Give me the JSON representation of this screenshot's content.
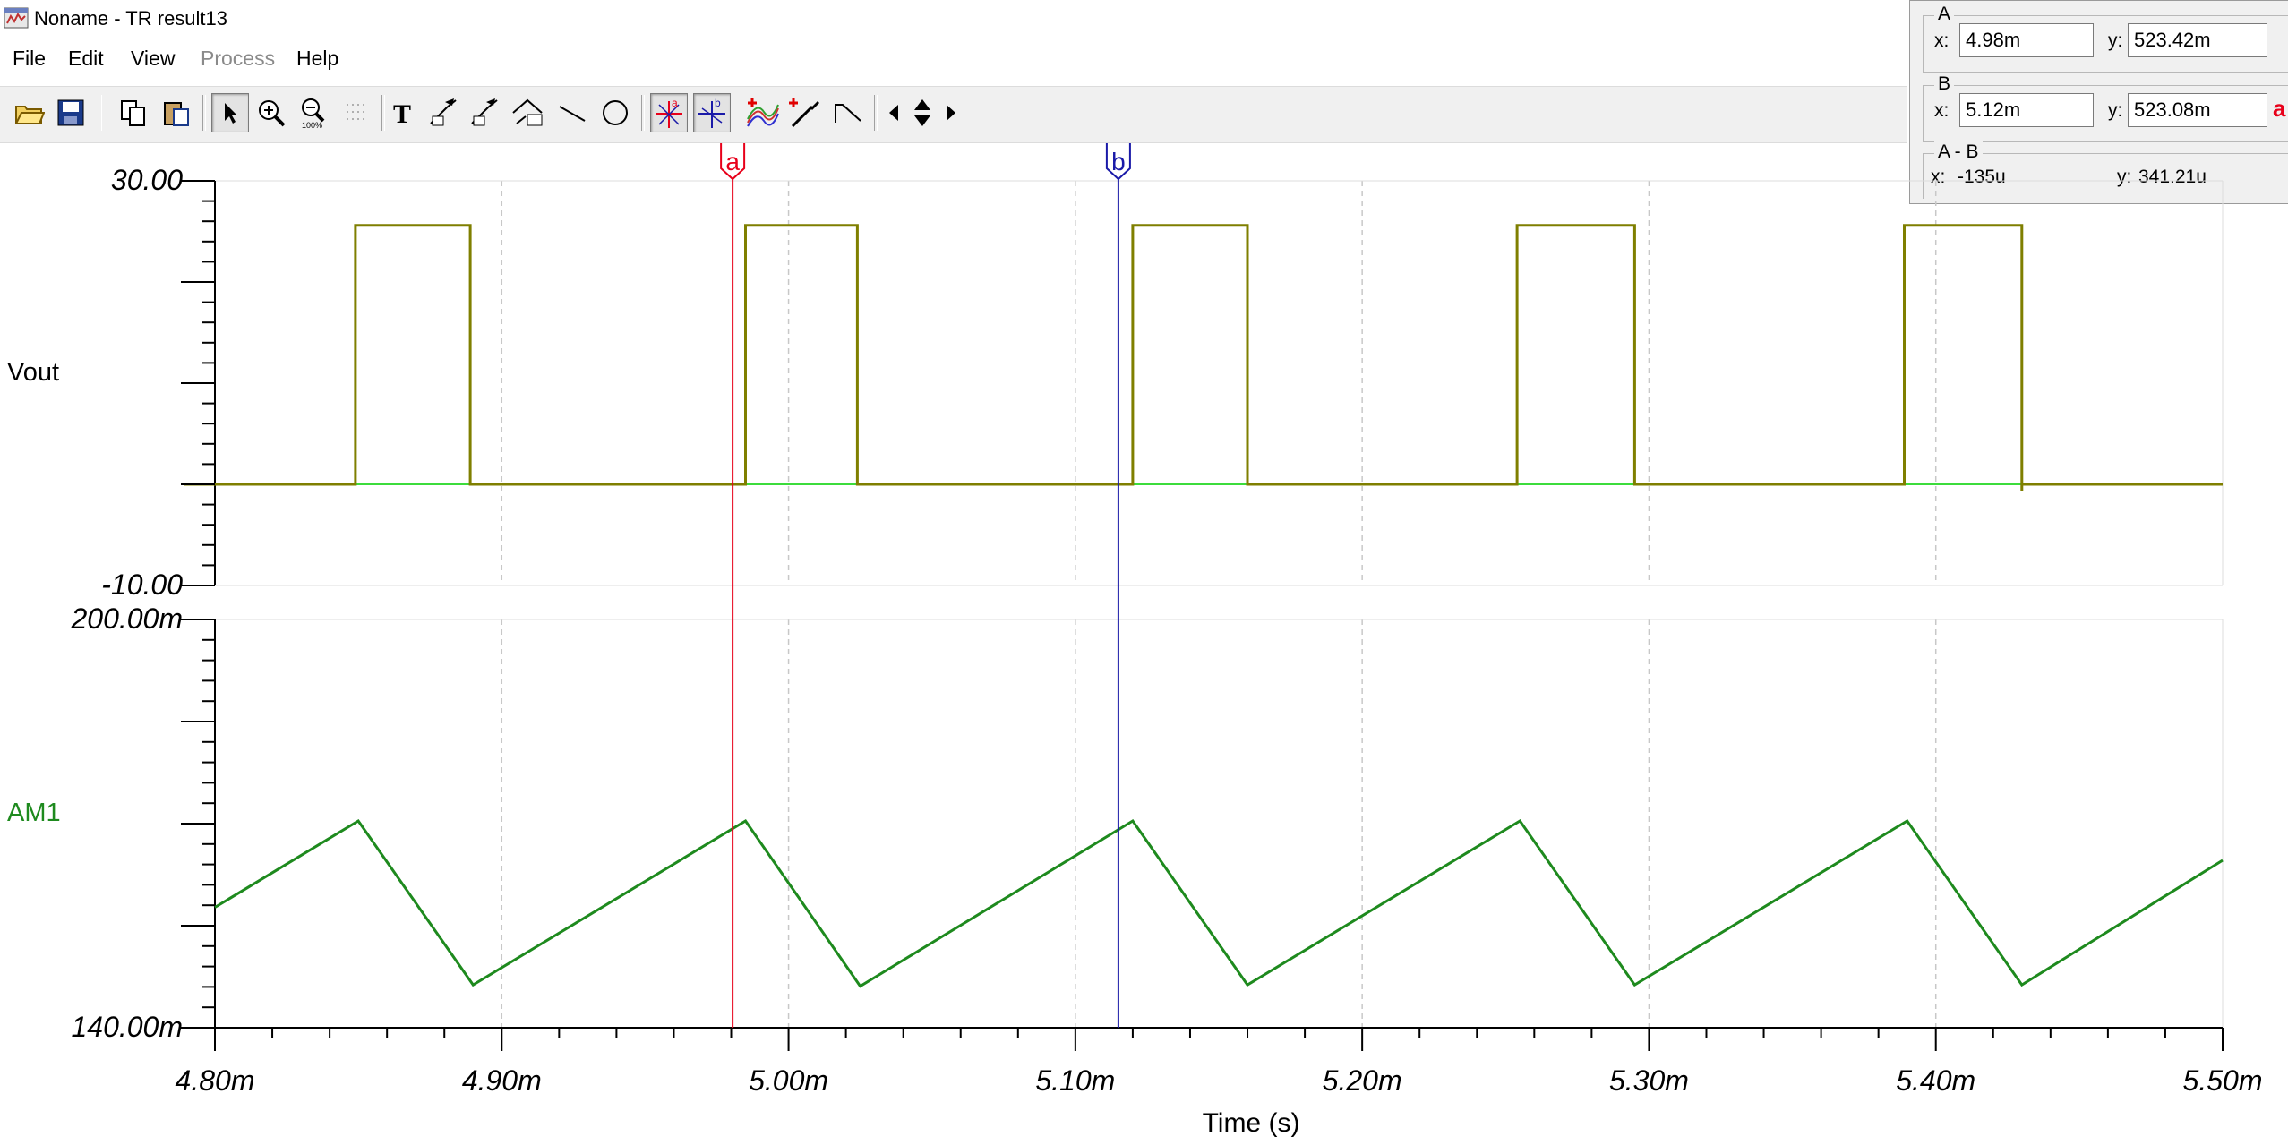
{
  "window": {
    "title": "Noname - TR result13"
  },
  "menu": {
    "file": "File",
    "edit": "Edit",
    "view": "View",
    "process": "Process",
    "help": "Help"
  },
  "toolbar": {
    "buttons": [
      "open-icon",
      "save-icon",
      "copy-icon",
      "paste-icon",
      "select-arrow-icon",
      "zoom-in-icon",
      "zoom-100-icon",
      "grid-icon",
      "text-icon",
      "label-tool-icon",
      "label-tool-2-icon",
      "diagram-label-icon",
      "line-icon",
      "circle-icon",
      "cursor-a-icon",
      "cursor-b-icon",
      "add-curve-icon",
      "probe-icon",
      "step-icon",
      "prev-icon",
      "updown-icon",
      "next-icon"
    ],
    "text_tool_glyph": "T"
  },
  "cursor_panel": {
    "a": {
      "title": "A",
      "x_label": "x:",
      "x_value": "4.98m",
      "y_label": "y:",
      "y_value": "523.42m"
    },
    "b": {
      "title": "B",
      "x_label": "x:",
      "x_value": "5.12m",
      "y_label": "y:",
      "y_value": "523.08m",
      "arrow_label": "a←"
    },
    "diff": {
      "title": "A - B",
      "x_label": "x:",
      "x_value": "-135u",
      "y_label": "y:",
      "y_value": "341.21u"
    }
  },
  "colors": {
    "vout": "#7f7f00",
    "am1": "#1e8a1e",
    "baseline": "#3cdc3c",
    "cursor_a": "#e8001a",
    "cursor_b": "#1a1aa8",
    "grid": "#c8c8c8"
  },
  "chart_data": [
    {
      "type": "line",
      "ylabel": "Vout",
      "ylim": [
        -10,
        30
      ],
      "ytick_labels": [
        "30.00",
        "-10.00"
      ],
      "grid": true,
      "series": [
        {
          "name": "Vout",
          "points": [
            [
              4.78,
              0
            ],
            [
              4.849,
              0
            ],
            [
              4.849,
              25.6
            ],
            [
              4.889,
              25.6
            ],
            [
              4.889,
              0
            ],
            [
              4.985,
              0
            ],
            [
              4.985,
              25.6
            ],
            [
              5.024,
              25.6
            ],
            [
              5.024,
              0
            ],
            [
              5.12,
              0
            ],
            [
              5.12,
              25.6
            ],
            [
              5.16,
              25.6
            ],
            [
              5.16,
              0
            ],
            [
              5.254,
              0
            ],
            [
              5.254,
              25.6
            ],
            [
              5.295,
              25.6
            ],
            [
              5.295,
              0
            ],
            [
              5.389,
              0
            ],
            [
              5.389,
              25.6
            ],
            [
              5.43,
              25.6
            ],
            [
              5.43,
              -0.7
            ],
            [
              5.43,
              0
            ],
            [
              5.5,
              0
            ]
          ]
        }
      ]
    },
    {
      "type": "line",
      "ylabel": "AM1",
      "ylim": [
        0.14,
        0.2
      ],
      "ytick_labels": [
        "200.00m",
        "140.00m"
      ],
      "xlabel": "Time (s)",
      "xlim": [
        4.8,
        5.5
      ],
      "xtick_labels": [
        "4.80m",
        "4.90m",
        "5.00m",
        "5.10m",
        "5.20m",
        "5.30m",
        "5.40m",
        "5.50m"
      ],
      "grid": true,
      "series": [
        {
          "name": "AM1",
          "points": [
            [
              4.8,
              0.1577
            ],
            [
              4.85,
              0.1704
            ],
            [
              4.89,
              0.1463
            ],
            [
              4.985,
              0.1704
            ],
            [
              5.025,
              0.1461
            ],
            [
              5.12,
              0.1704
            ],
            [
              5.16,
              0.1463
            ],
            [
              5.255,
              0.1704
            ],
            [
              5.295,
              0.1463
            ],
            [
              5.39,
              0.1704
            ],
            [
              5.43,
              0.1463
            ],
            [
              5.5,
              0.1646
            ]
          ]
        }
      ]
    }
  ],
  "cursors": {
    "a": {
      "label": "a",
      "x": 4.9805
    },
    "b": {
      "label": "b",
      "x": 5.115
    }
  }
}
